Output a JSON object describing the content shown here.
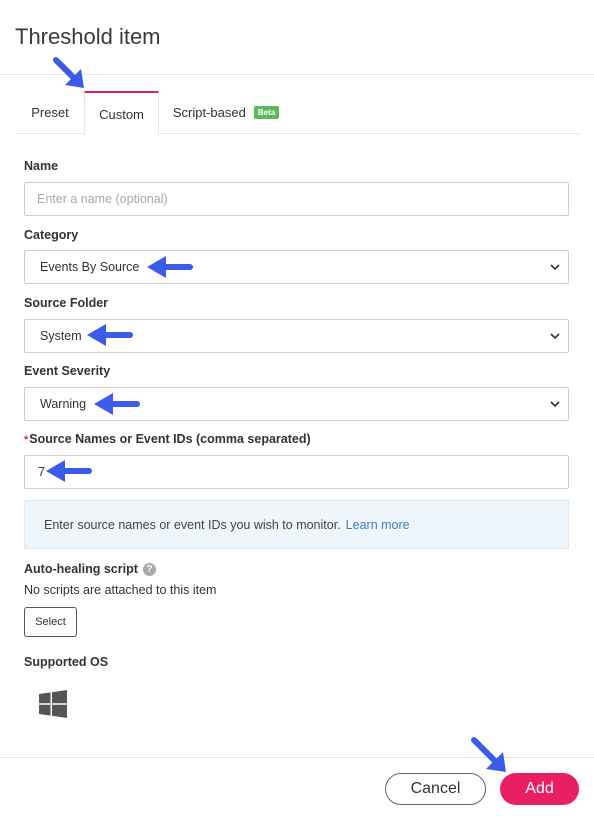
{
  "dialog": {
    "title": "Threshold item"
  },
  "tabs": [
    {
      "label": "Preset"
    },
    {
      "label": "Custom",
      "active": true
    },
    {
      "label": "Script-based",
      "badge": "Beta"
    }
  ],
  "form": {
    "name": {
      "label": "Name",
      "placeholder": "Enter a name (optional)",
      "value": ""
    },
    "category": {
      "label": "Category",
      "value": "Events By Source"
    },
    "source_folder": {
      "label": "Source Folder",
      "value": "System"
    },
    "event_severity": {
      "label": "Event Severity",
      "value": "Warning"
    },
    "source_names": {
      "required_mark": "*",
      "label": "Source Names or Event IDs (comma separated)",
      "value": "7"
    },
    "info": {
      "text": "Enter source names or event IDs you wish to monitor.",
      "link": "Learn more"
    },
    "auto_healing": {
      "label": "Auto-healing script",
      "help_icon": "?",
      "status": "No scripts are attached to this item",
      "select_label": "Select"
    },
    "supported_os": {
      "label": "Supported OS",
      "icons": [
        "windows-icon"
      ]
    }
  },
  "footer": {
    "cancel_label": "Cancel",
    "add_label": "Add"
  },
  "colors": {
    "accent": "#e91e63",
    "tab_active": "#e2216b",
    "beta_badge": "#5cb85c",
    "link": "#3b7fc4",
    "annotation_arrow": "#3b5ce8"
  }
}
